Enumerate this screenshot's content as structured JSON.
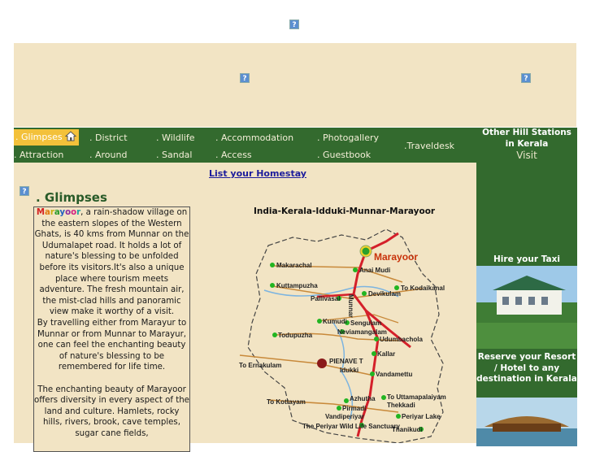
{
  "nav": {
    "row1": [
      "Glimpses",
      ". District",
      ". Wildlife",
      ". Accommodation",
      ". Photogallery"
    ],
    "traveldesk": ".Traveldesk",
    "row2": [
      ". Attraction",
      ". Around",
      ". Sandal",
      ". Access",
      ". Guestbook"
    ]
  },
  "homestay_link": "List your Homestay",
  "page_title": ". Glimpses",
  "article": {
    "village": "Marayoor",
    "para1_rest": ", a rain-shadow village on the eastern slopes of the Western Ghats, is 40 kms from Munnar on the Udumalapet road. It holds a lot of nature's blessing to be unfolded before its visitors.It's also a unique place where tourism meets adventure. The fresh mountain air, the mist-clad hills and panoramic view make it worthy of a visit.",
    "para2": "By travelling either from Marayur to Munnar or from Munnar to Marayur, one can feel the enchanting beauty of nature's blessing to be remembered for life time.",
    "para3": "The enchanting beauty of Marayoor offers diversity in every aspect of the land and culture. Hamlets, rocky hills, rivers, brook, cave temples, sugar cane fields,"
  },
  "map": {
    "title": "India-Kerala-Idduki-Munnar-Marayoor",
    "places": [
      "Marayoor",
      "Makarachal",
      "Anai Mudi",
      "Kuttampuzha",
      "Devikulam",
      "To Kodaikanal",
      "Pallivasal",
      "Munnar",
      "Kumudi",
      "Sengulam",
      "Neviamangalam",
      "Todupuzha",
      "Udumbachola",
      "Kallar",
      "PIENAVE T",
      "Idukki",
      "To Ernakulam",
      "Vandamettu",
      "To Kottayam",
      "Azhutha",
      "To Uttamapalaiyam",
      "Thekkadi",
      "Pirmadi",
      "Vandiperiyar",
      "Periyar Lake",
      "The Periyar Wild Life Sanctuary",
      "Thanikudi"
    ]
  },
  "sidebar": {
    "other_hills": "Other Hill Stations in Kerala",
    "visit": "Visit",
    "taxi": "Hire your Taxi",
    "resort": "Reserve your Resort / Hotel to any destination in Kerala"
  },
  "colors": {
    "nav_green": "#336a2e",
    "cream": "#f2e4c4",
    "active_tab": "#f3c13a",
    "link_blue": "#1c1c9c"
  },
  "icons": [
    "broken-image-icon",
    "home-icon"
  ]
}
